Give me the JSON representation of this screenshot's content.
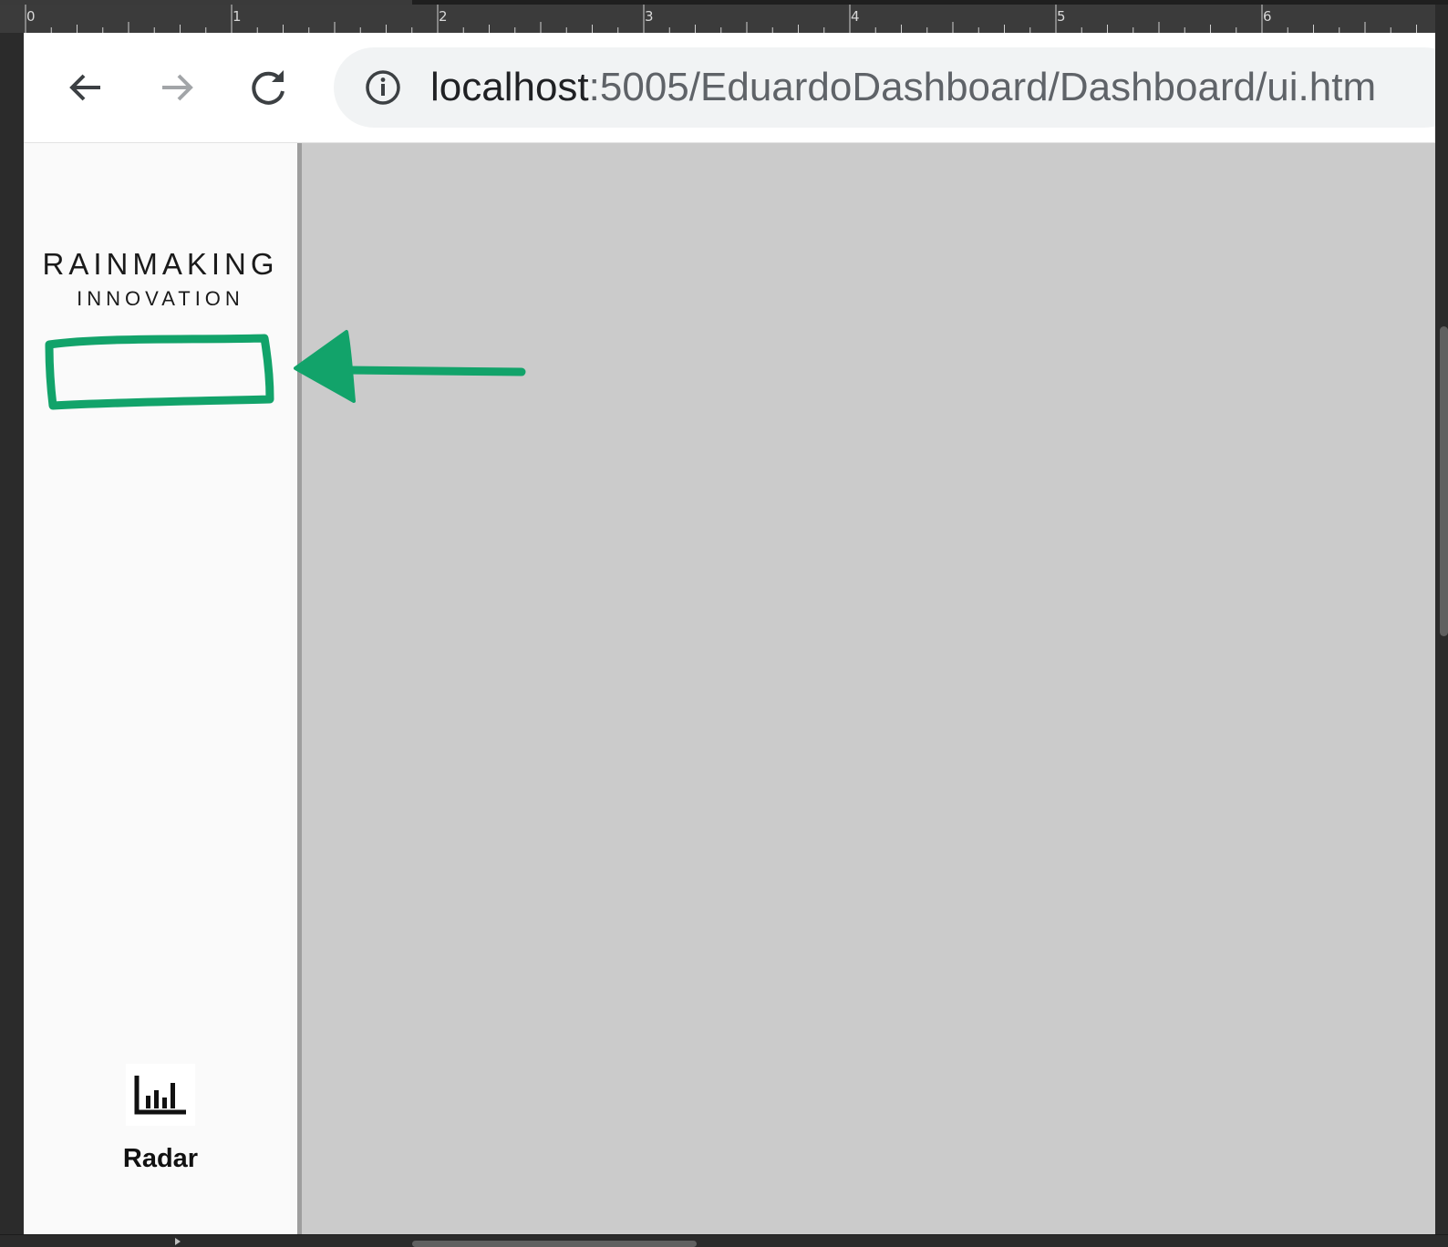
{
  "ruler": {
    "marks": [
      "0",
      "1",
      "2",
      "3",
      "4",
      "5",
      "6"
    ]
  },
  "browser": {
    "nav": {
      "back_icon": "arrow-left-icon",
      "forward_icon": "arrow-right-icon",
      "reload_icon": "reload-icon",
      "site_info_icon": "info-icon"
    },
    "url": {
      "host": "localhost",
      "path": ":5005/EduardoDashboard/Dashboard/ui.htm"
    }
  },
  "sidebar": {
    "logo": {
      "line1": "RAINMAKING",
      "line2": "INNOVATION"
    },
    "nav_items": [
      {
        "label": "Radar",
        "icon": "bar-chart-icon"
      }
    ]
  },
  "annotation": {
    "color": "#12a36a",
    "shapes": [
      "highlight-rectangle",
      "arrow"
    ]
  },
  "colors": {
    "main_background": "#cbcbcb",
    "sidebar_background": "#fafafa",
    "sidebar_border": "#9e9e9e"
  }
}
